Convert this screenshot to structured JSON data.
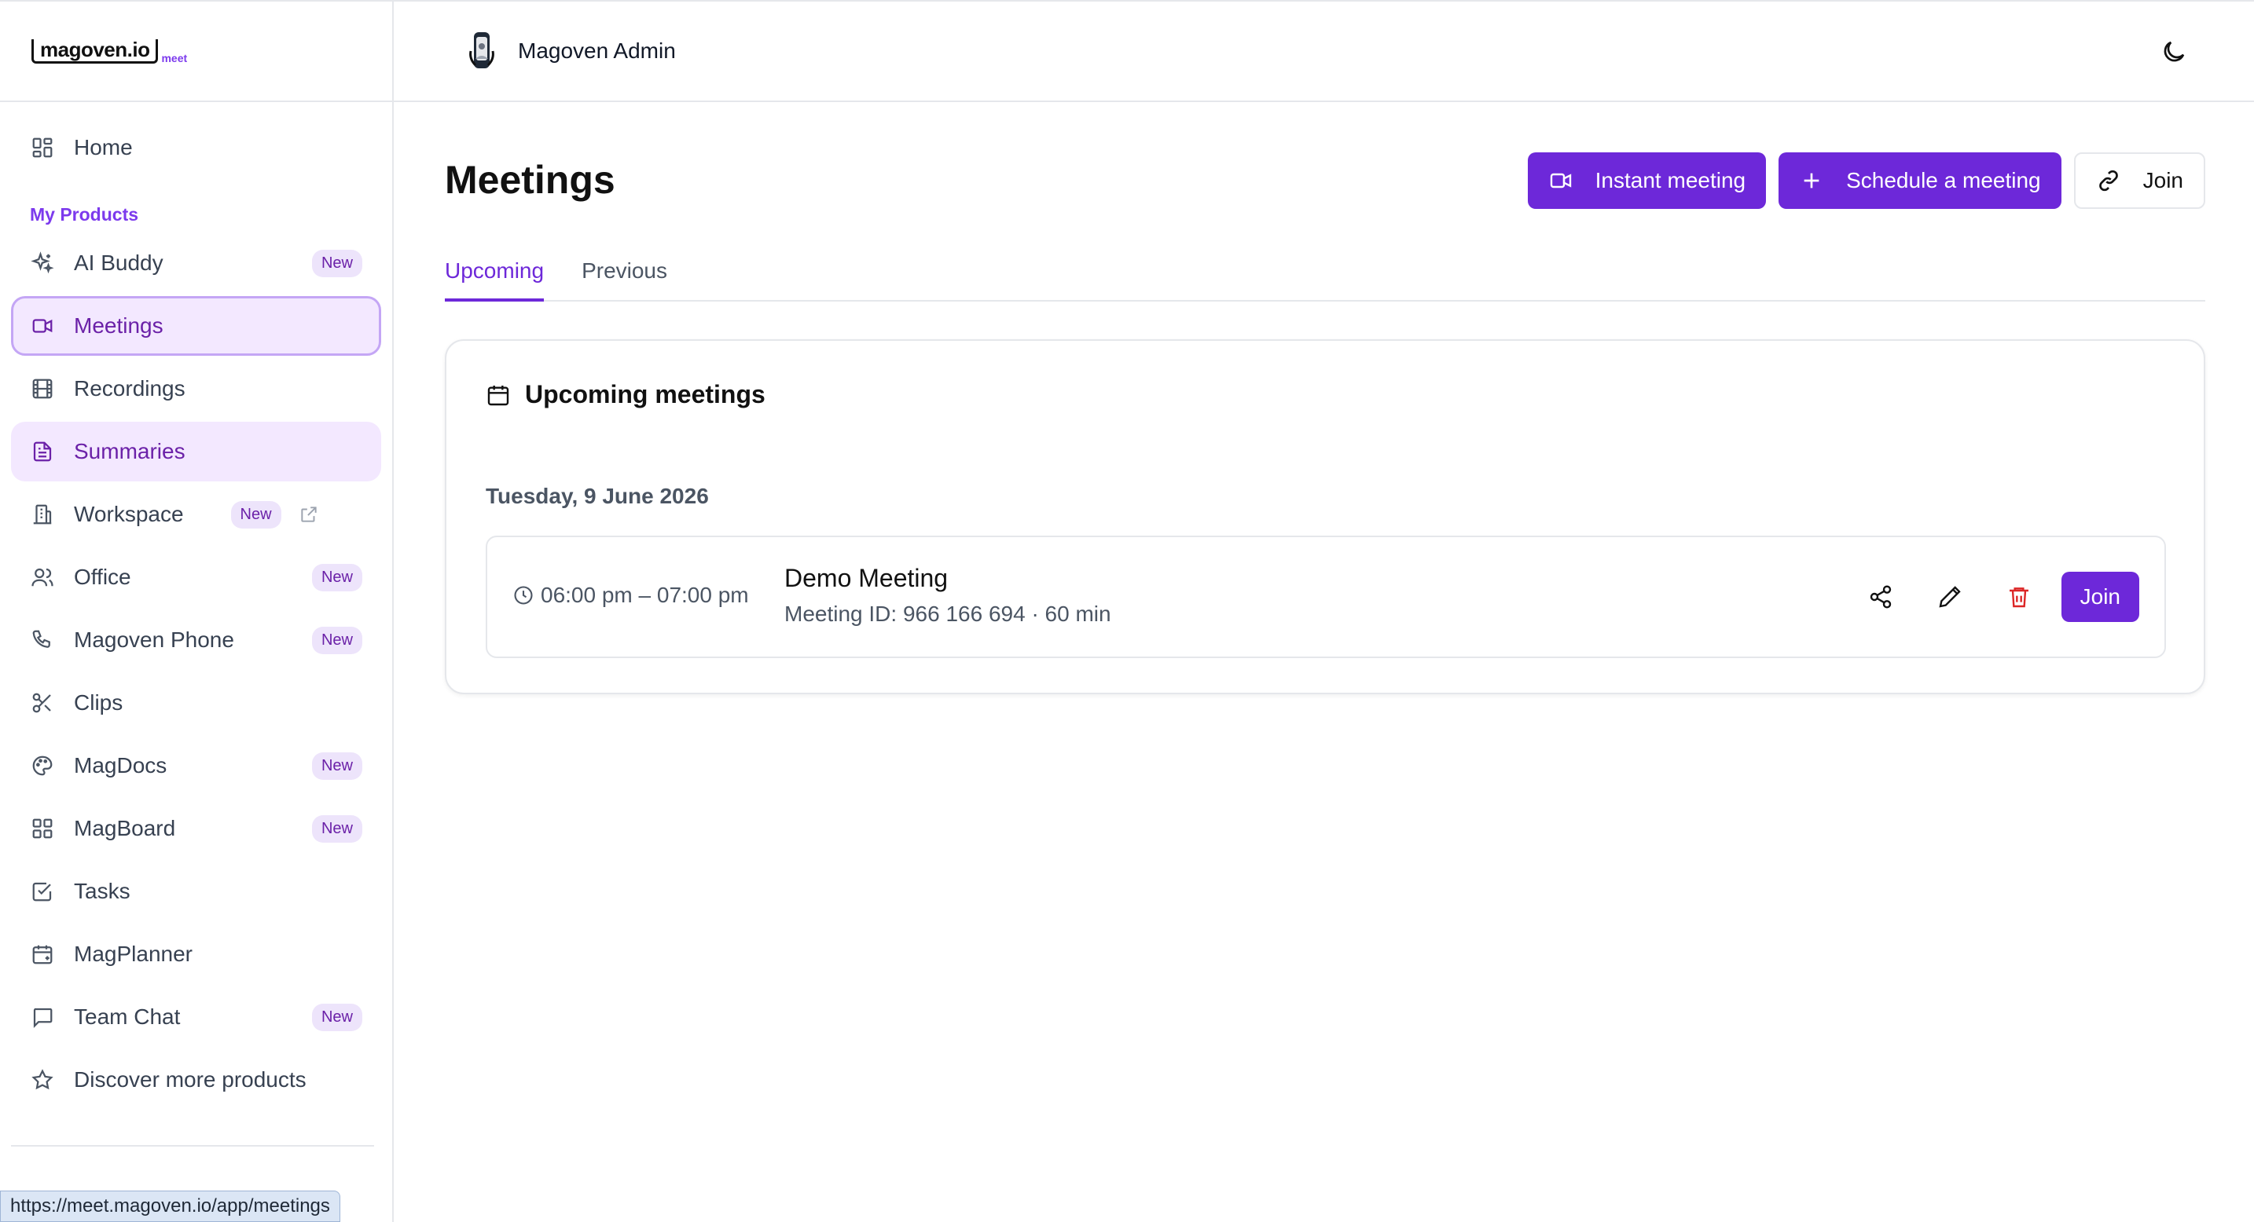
{
  "brand": {
    "logo_text": "magoven.io",
    "logo_sub": "meet",
    "accent": "#6d28d9"
  },
  "sidebar": {
    "home_label": "Home",
    "section_label": "My Products",
    "items": [
      {
        "label": "AI Buddy",
        "icon": "sparkles-icon",
        "badge": "New"
      },
      {
        "label": "Meetings",
        "icon": "video-icon",
        "badge": ""
      },
      {
        "label": "Recordings",
        "icon": "film-icon",
        "badge": ""
      },
      {
        "label": "Summaries",
        "icon": "document-icon",
        "badge": ""
      },
      {
        "label": "Workspace",
        "icon": "building-icon",
        "badge": "New"
      },
      {
        "label": "Office",
        "icon": "users-icon",
        "badge": "New"
      },
      {
        "label": "Magoven Phone",
        "icon": "phone-icon",
        "badge": "New"
      },
      {
        "label": "Clips",
        "icon": "scissors-icon",
        "badge": ""
      },
      {
        "label": "MagDocs",
        "icon": "palette-icon",
        "badge": "New"
      },
      {
        "label": "MagBoard",
        "icon": "grid-icon",
        "badge": "New"
      },
      {
        "label": "Tasks",
        "icon": "checkbox-icon",
        "badge": ""
      },
      {
        "label": "MagPlanner",
        "icon": "calendar-icon",
        "badge": ""
      },
      {
        "label": "Team Chat",
        "icon": "chat-icon",
        "badge": "New"
      },
      {
        "label": "Discover more products",
        "icon": "star-icon",
        "badge": ""
      }
    ]
  },
  "status_bar": {
    "url": "https://meet.magoven.io/app/meetings"
  },
  "header": {
    "admin_name": "Magoven Admin"
  },
  "page": {
    "title": "Meetings",
    "actions": {
      "instant": "Instant meeting",
      "schedule": "Schedule a meeting",
      "join": "Join"
    },
    "tabs": [
      {
        "label": "Upcoming",
        "active": true
      },
      {
        "label": "Previous",
        "active": false
      }
    ]
  },
  "upcoming": {
    "card_title": "Upcoming meetings",
    "date": "Tuesday, 9 June 2026",
    "meetings": [
      {
        "time": "06:00 pm – 07:00 pm",
        "title": "Demo Meeting",
        "subtitle": "Meeting ID: 966 166 694 · 60 min",
        "join_label": "Join"
      }
    ]
  }
}
